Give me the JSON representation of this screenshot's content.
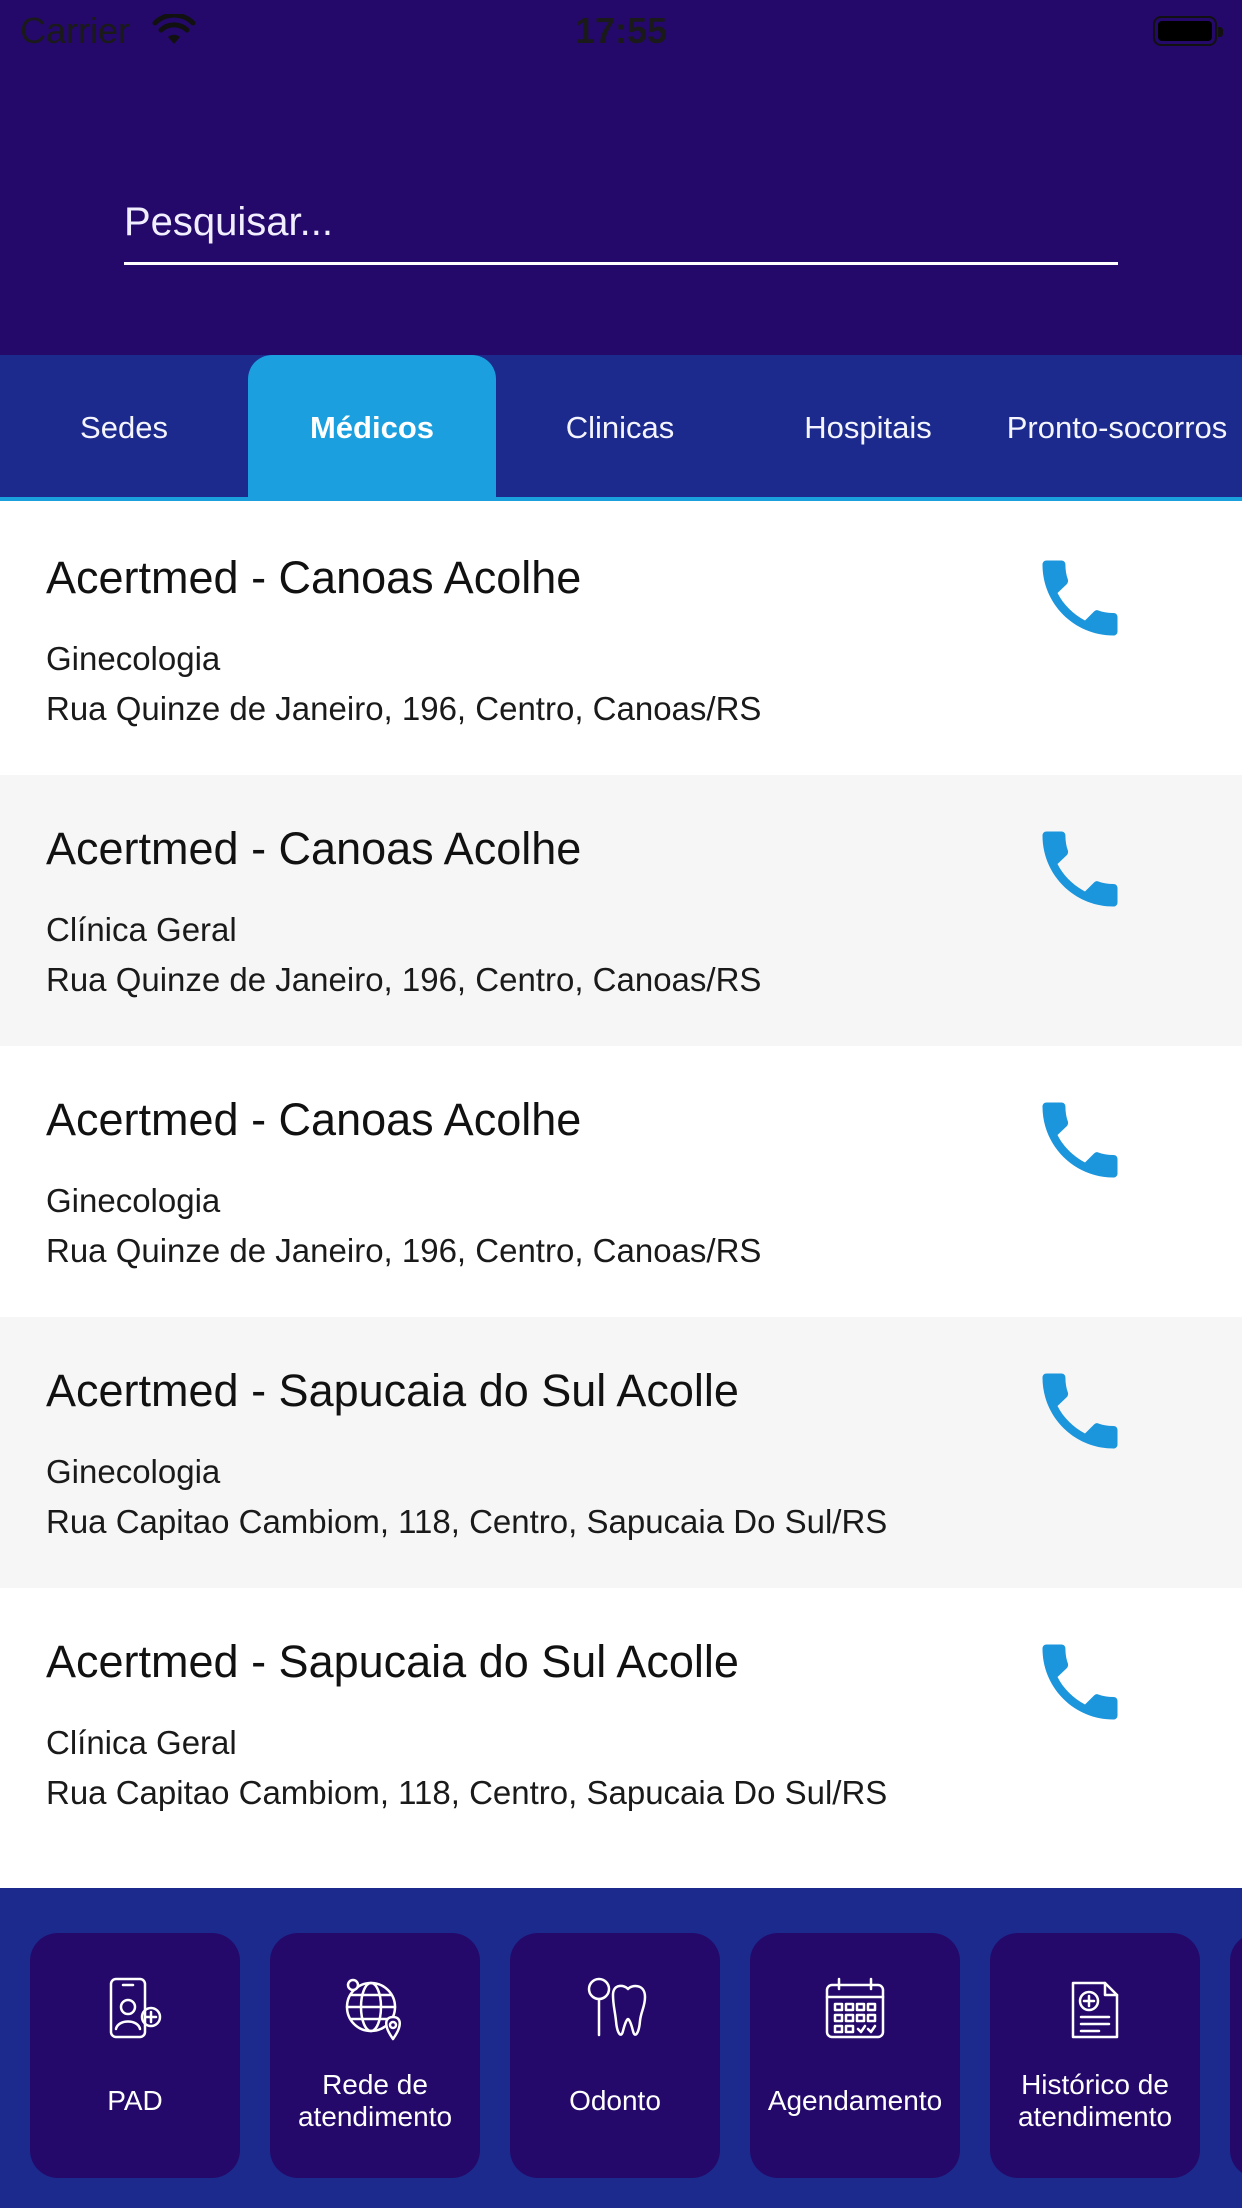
{
  "status_bar": {
    "carrier": "Carrier",
    "time": "17:55"
  },
  "search": {
    "placeholder": "Pesquisar..."
  },
  "tabs": [
    {
      "label": "Sedes",
      "active": false
    },
    {
      "label": "Médicos",
      "active": true
    },
    {
      "label": "Clinicas",
      "active": false
    },
    {
      "label": "Hospitais",
      "active": false
    },
    {
      "label": "Pronto-socorros",
      "active": false
    }
  ],
  "results": [
    {
      "name": "Acertmed - Canoas Acolhe",
      "specialty": "Ginecologia",
      "address": "Rua Quinze de Janeiro, 196, Centro, Canoas/RS"
    },
    {
      "name": "Acertmed - Canoas Acolhe",
      "specialty": "Clínica Geral",
      "address": "Rua Quinze de Janeiro, 196, Centro, Canoas/RS"
    },
    {
      "name": "Acertmed - Canoas Acolhe",
      "specialty": "Ginecologia",
      "address": "Rua Quinze de Janeiro, 196, Centro, Canoas/RS"
    },
    {
      "name": "Acertmed - Sapucaia do Sul Acolle",
      "specialty": "Ginecologia",
      "address": "Rua Capitao Cambiom, 118, Centro, Sapucaia Do Sul/RS"
    },
    {
      "name": "Acertmed - Sapucaia do Sul Acolle",
      "specialty": "Clínica Geral",
      "address": "Rua Capitao Cambiom, 118, Centro, Sapucaia Do Sul/RS"
    }
  ],
  "bottom_menu": [
    {
      "label": "PAD",
      "icon": "pad-icon"
    },
    {
      "label": "Rede de atendimento",
      "icon": "network-globe-icon"
    },
    {
      "label": "Odonto",
      "icon": "tooth-icon"
    },
    {
      "label": "Agendamento",
      "icon": "calendar-icon"
    },
    {
      "label": "Histórico de atendimento",
      "icon": "medical-record-icon"
    }
  ],
  "colors": {
    "header": "#24096b",
    "tabbar": "#1b2a8c",
    "accent": "#1b9fde",
    "alt_row": "#f6f6f6"
  }
}
